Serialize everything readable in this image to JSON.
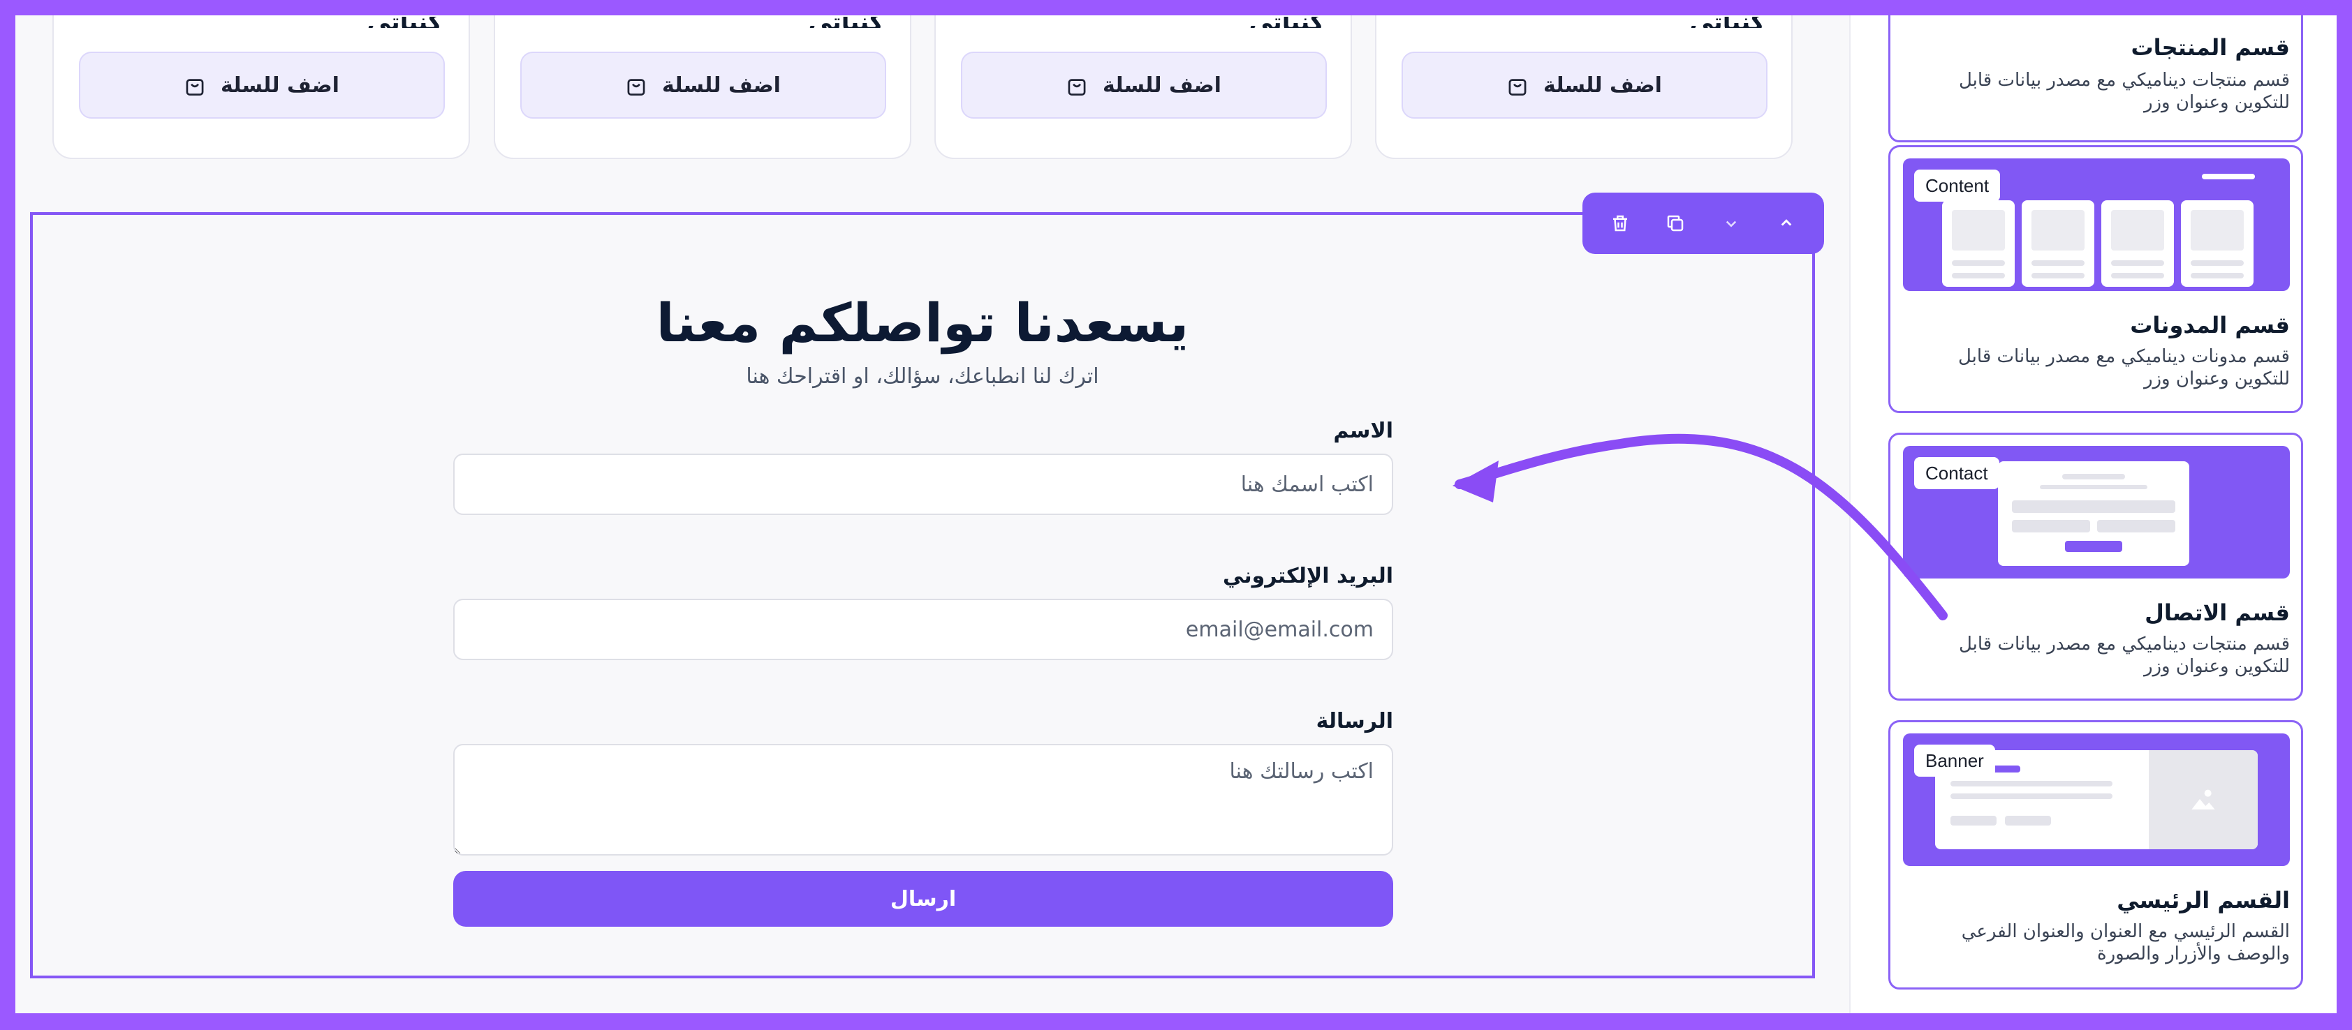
{
  "products": [
    {
      "name": "كنباتي",
      "button_label": "اضف للسلة"
    },
    {
      "name": "كنباتي",
      "button_label": "اضف للسلة"
    },
    {
      "name": "كنباتي",
      "button_label": "اضف للسلة"
    },
    {
      "name": "كنباتي",
      "button_label": "اضف للسلة"
    }
  ],
  "contact": {
    "title": "يسعدنا تواصلكم معنا",
    "subtitle": "اترك لنا انطباعك، سؤالك، او اقتراحك هنا",
    "fields": {
      "name": {
        "label": "الاسم",
        "placeholder": "اكتب اسمك هنا",
        "value": ""
      },
      "email": {
        "label": "البريد الإلكتروني",
        "placeholder": "email@email.com",
        "value": ""
      },
      "message": {
        "label": "الرسالة",
        "placeholder": "اكتب رسالتك هنا",
        "value": ""
      }
    },
    "submit_label": "ارسال"
  },
  "toolbar": {
    "icons": [
      "trash-icon",
      "duplicate-icon",
      "chevron-down-icon",
      "chevron-up-icon"
    ]
  },
  "sidebar": {
    "sections": [
      {
        "badge": "",
        "title": "قسم المنتجات",
        "description": "قسم منتجات ديناميكي مع مصدر بيانات قابل للتكوين وعنوان وزر"
      },
      {
        "badge": "Content",
        "title": "قسم المدونات",
        "description": "قسم مدونات ديناميكي مع مصدر بيانات قابل للتكوين وعنوان وزر"
      },
      {
        "badge": "Contact",
        "title": "قسم الاتصال",
        "description": "قسم منتجات ديناميكي مع مصدر بيانات قابل للتكوين وعنوان وزر"
      },
      {
        "badge": "Banner",
        "title": "القسم الرئيسي",
        "description": "القسم الرئيسي مع العنوان والعنوان الفرعي والوصف والأزرار والصورة"
      }
    ]
  },
  "colors": {
    "accent": "#7f56f6",
    "frame": "#9b59ff",
    "section_border": "#8557f5",
    "button_tint": "#efedfd"
  }
}
